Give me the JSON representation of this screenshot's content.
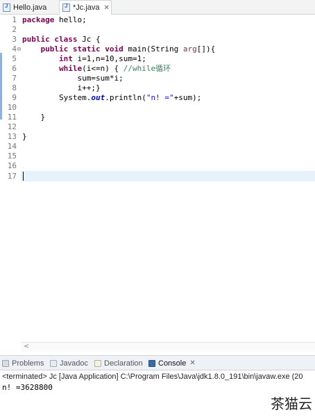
{
  "tabs": [
    {
      "label": "Hello.java",
      "active": false
    },
    {
      "label": "*Jc.java",
      "active": true,
      "close": "✕"
    }
  ],
  "editor": {
    "line_numbers": [
      "1",
      "2",
      "3",
      "4",
      "5",
      "6",
      "7",
      "8",
      "9",
      "10",
      "11",
      "12",
      "13",
      "14",
      "15",
      "16",
      "17"
    ],
    "fold_marker": "⊖",
    "code": {
      "l1_kw": "package",
      "l1_rest": " hello;",
      "l3_kw1": "public",
      "l3_kw2": "class",
      "l3_rest": " Jc {",
      "l4_indent": "    ",
      "l4_kw1": "public",
      "l4_kw2": "static",
      "l4_kw3": "void",
      "l4_mid": " main(String ",
      "l4_param": "arg",
      "l4_end": "[]){",
      "l5_indent": "        ",
      "l5_kw": "int",
      "l5_rest": " i=1,n=10,sum=1;",
      "l6_indent": "        ",
      "l6_kw": "while",
      "l6_rest": "(i<=n) { ",
      "l6_comment": "//while循环",
      "l7_text": "            sum=sum*i;",
      "l8_text": "            i++;}",
      "l9_indent": "        ",
      "l9_pre": "System.",
      "l9_field": "out",
      "l9_mid": ".println(",
      "l9_str": "\"n! =\"",
      "l9_end": "+sum);",
      "l11_text": "    }",
      "l13_text": "}"
    },
    "scroll_left": "<"
  },
  "panel": {
    "tabs": [
      {
        "label": "Problems"
      },
      {
        "label": "Javadoc"
      },
      {
        "label": "Declaration"
      },
      {
        "label": "Console",
        "active": true,
        "close": "✕"
      }
    ]
  },
  "console": {
    "status": "<terminated> Jc [Java Application] C:\\Program Files\\Java\\jdk1.8.0_191\\bin\\javaw.exe (20",
    "output": "n! =3628800"
  },
  "watermark": "茶猫云",
  "colors": {
    "keyword": "#7f0055",
    "comment": "#3f7f5f",
    "string": "#2a00ff",
    "field": "#0000c0",
    "current_line": "#e8f2fe"
  }
}
